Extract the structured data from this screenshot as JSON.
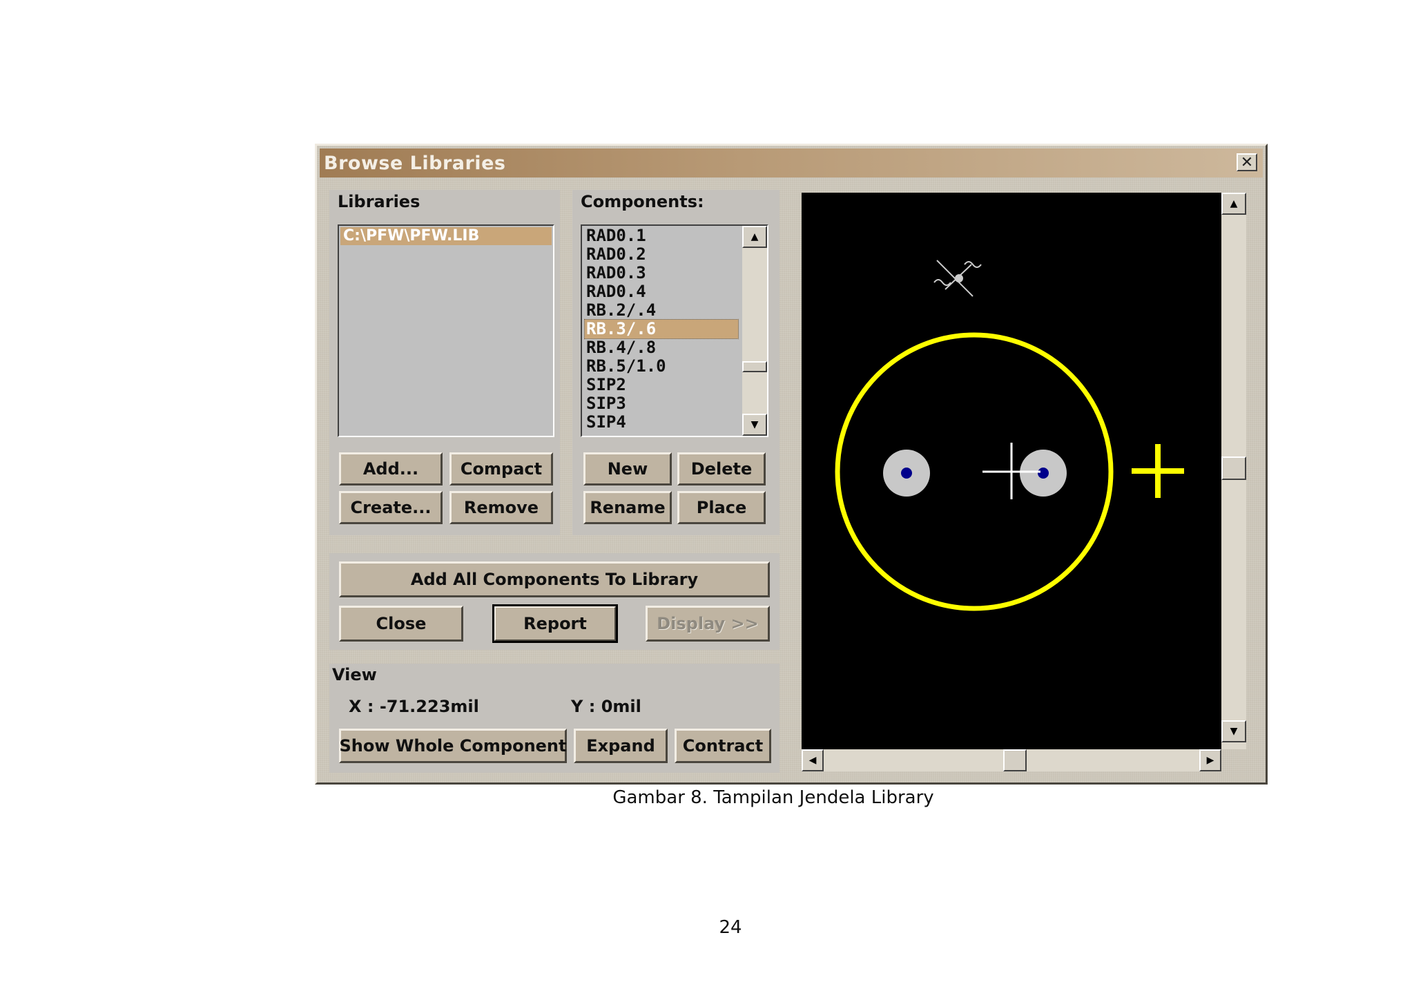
{
  "window": {
    "title": "Browse Libraries",
    "close_glyph": "✕"
  },
  "libraries": {
    "label": "Libraries",
    "items": [
      "C:\\PFW\\PFW.LIB"
    ],
    "buttons": {
      "add": "Add...",
      "compact": "Compact",
      "create": "Create...",
      "remove": "Remove"
    }
  },
  "components": {
    "label": "Components:",
    "items": [
      "RAD0.1",
      "RAD0.2",
      "RAD0.3",
      "RAD0.4",
      "RB.2/.4",
      "RB.3/.6",
      "RB.4/.8",
      "RB.5/1.0",
      "SIP2",
      "SIP3",
      "SIP4"
    ],
    "selected": "RB.3/.6",
    "buttons": {
      "new": "New",
      "delete": "Delete",
      "rename": "Rename",
      "place": "Place"
    }
  },
  "actions": {
    "add_all": "Add All Components To Library",
    "close": "Close",
    "report": "Report",
    "display": "Display >>"
  },
  "view": {
    "label": "View",
    "x": "X : -71.223mil",
    "y": "Y : 0mil",
    "show_whole": "Show Whole Component",
    "expand": "Expand",
    "contract": "Contract"
  },
  "preview": {
    "background": "#000000",
    "outline_color": "#ffff00",
    "pad_color": "#c8c8c8",
    "hole_color": "#00008b"
  },
  "caption": "Gambar 8. Tampilan Jendela Library",
  "page_number": "24"
}
